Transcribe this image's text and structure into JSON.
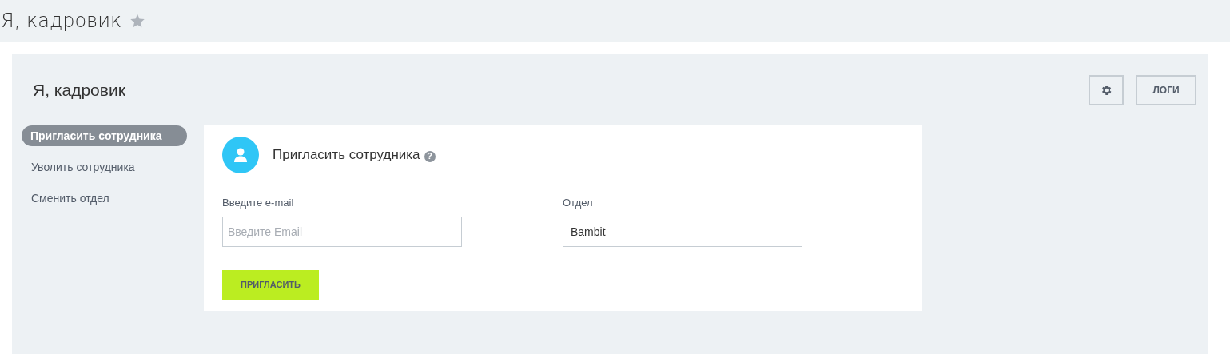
{
  "page_title": "Я, кадровик",
  "favorite": false,
  "panel": {
    "title": "Я, кадровик",
    "actions": [
      {
        "kind": "settings"
      },
      {
        "kind": "text",
        "label": "ЛОГИ"
      }
    ]
  },
  "sidebar": {
    "items": [
      {
        "label": "Пригласить сотрудника",
        "selected": true
      },
      {
        "label": "Уволить сотрудника",
        "selected": false
      },
      {
        "label": "Сменить отдел",
        "selected": false
      }
    ]
  },
  "form": {
    "title": "Пригласить сотрудника",
    "help": "?",
    "fields": [
      {
        "label": "Введите e-mail",
        "placeholder": "Введите Email"
      },
      {
        "label": "Отдел",
        "value": "Bambit"
      }
    ],
    "submit": "ПРИГЛАСИТЬ"
  }
}
